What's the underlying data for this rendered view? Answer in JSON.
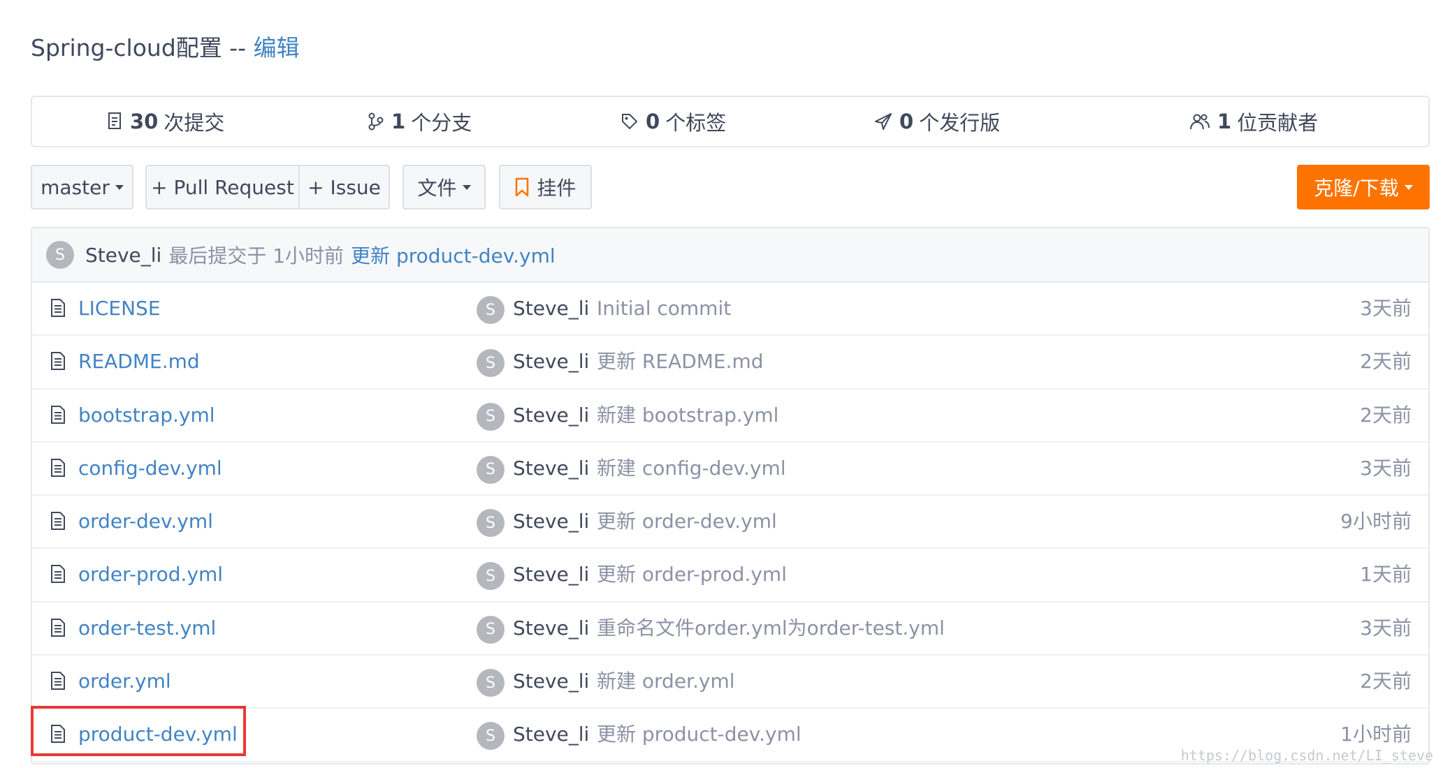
{
  "repo": {
    "name": "Spring-cloud配置",
    "separator": "--",
    "edit_label": "编辑"
  },
  "stats": [
    {
      "icon": "commits-icon",
      "count": "30",
      "label": "次提交"
    },
    {
      "icon": "branch-icon",
      "count": "1",
      "label": "个分支"
    },
    {
      "icon": "tag-icon",
      "count": "0",
      "label": "个标签"
    },
    {
      "icon": "release-icon",
      "count": "0",
      "label": "个发行版"
    },
    {
      "icon": "contributors-icon",
      "count": "1",
      "label": "位贡献者"
    }
  ],
  "toolbar": {
    "branch": "master",
    "pull_request": "+ Pull Request",
    "issue": "+ Issue",
    "file": "文件",
    "widget": "挂件",
    "clone": "克隆/下载"
  },
  "last_commit": {
    "avatar_letter": "S",
    "author": "Steve_li",
    "meta": "最后提交于 1小时前",
    "message": "更新 product-dev.yml"
  },
  "files": [
    {
      "name": "LICENSE",
      "avatar_letter": "S",
      "author": "Steve_li",
      "message": "Initial commit",
      "time": "3天前"
    },
    {
      "name": "README.md",
      "avatar_letter": "S",
      "author": "Steve_li",
      "message": "更新 README.md",
      "time": "2天前"
    },
    {
      "name": "bootstrap.yml",
      "avatar_letter": "S",
      "author": "Steve_li",
      "message": "新建 bootstrap.yml",
      "time": "2天前"
    },
    {
      "name": "config-dev.yml",
      "avatar_letter": "S",
      "author": "Steve_li",
      "message": "新建 config-dev.yml",
      "time": "3天前"
    },
    {
      "name": "order-dev.yml",
      "avatar_letter": "S",
      "author": "Steve_li",
      "message": "更新 order-dev.yml",
      "time": "9小时前"
    },
    {
      "name": "order-prod.yml",
      "avatar_letter": "S",
      "author": "Steve_li",
      "message": "更新 order-prod.yml",
      "time": "1天前"
    },
    {
      "name": "order-test.yml",
      "avatar_letter": "S",
      "author": "Steve_li",
      "message": "重命名文件order.yml为order-test.yml",
      "time": "3天前"
    },
    {
      "name": "order.yml",
      "avatar_letter": "S",
      "author": "Steve_li",
      "message": "新建 order.yml",
      "time": "2天前"
    },
    {
      "name": "product-dev.yml",
      "avatar_letter": "S",
      "author": "Steve_li",
      "message": "更新 product-dev.yml",
      "time": "1小时前"
    }
  ],
  "watermark": "https://blog.csdn.net/LI_steve",
  "colors": {
    "link": "#4183c4",
    "accent": "#fe7300",
    "highlight": "#e53935"
  }
}
